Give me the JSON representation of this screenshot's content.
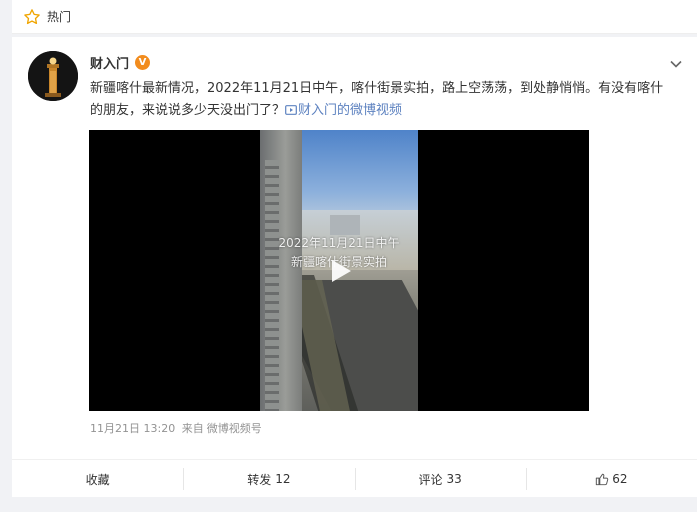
{
  "hot_bar": {
    "icon": "star-icon",
    "label": "热门"
  },
  "post": {
    "author": "财入门",
    "verified_badge": "V",
    "text": "新疆喀什最新情况，2022年11月21日中午，喀什街景实拍，路上空荡荡，到处静悄悄。有没有喀什的朋友，来说说多少天没出门了？",
    "link_text": "财入门的微博视频",
    "video": {
      "overlay_line1": "2022年11月21日中午",
      "overlay_line2": "新疆喀什街景实拍"
    },
    "timestamp": "11月21日 13:20",
    "source_prefix": "来自",
    "source": "微博视频号"
  },
  "actions": {
    "favorite_label": "收藏",
    "repost_label": "转发",
    "repost_count": "12",
    "comment_label": "评论",
    "comment_count": "33",
    "like_count": "62"
  },
  "colors": {
    "link": "#5d82c0",
    "badge": "#f28c1d",
    "meta": "#939393"
  }
}
